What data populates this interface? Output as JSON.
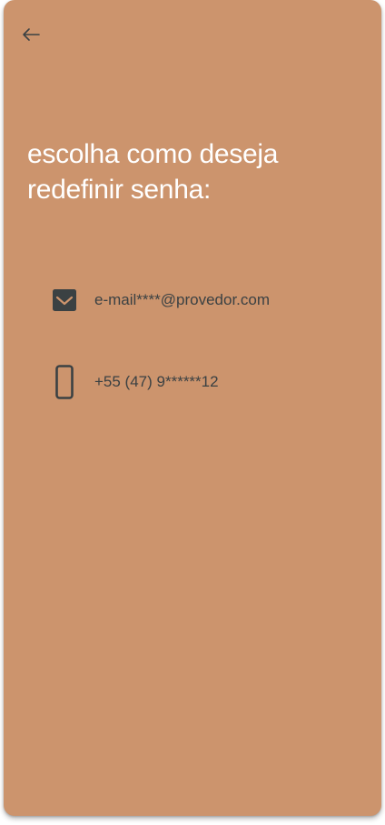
{
  "colors": {
    "card_background": "#cc946d",
    "title_text": "#ffffff",
    "option_text": "#3b4143",
    "icon": "#3b4143"
  },
  "header": {
    "back_icon": "arrow-left-icon"
  },
  "title": {
    "line1": "escolha como deseja",
    "line2": "redefinir senha:"
  },
  "options": [
    {
      "icon": "email-icon",
      "label": "e-mail****@provedor.com"
    },
    {
      "icon": "smartphone-icon",
      "label": "+55 (47) 9******12"
    }
  ]
}
